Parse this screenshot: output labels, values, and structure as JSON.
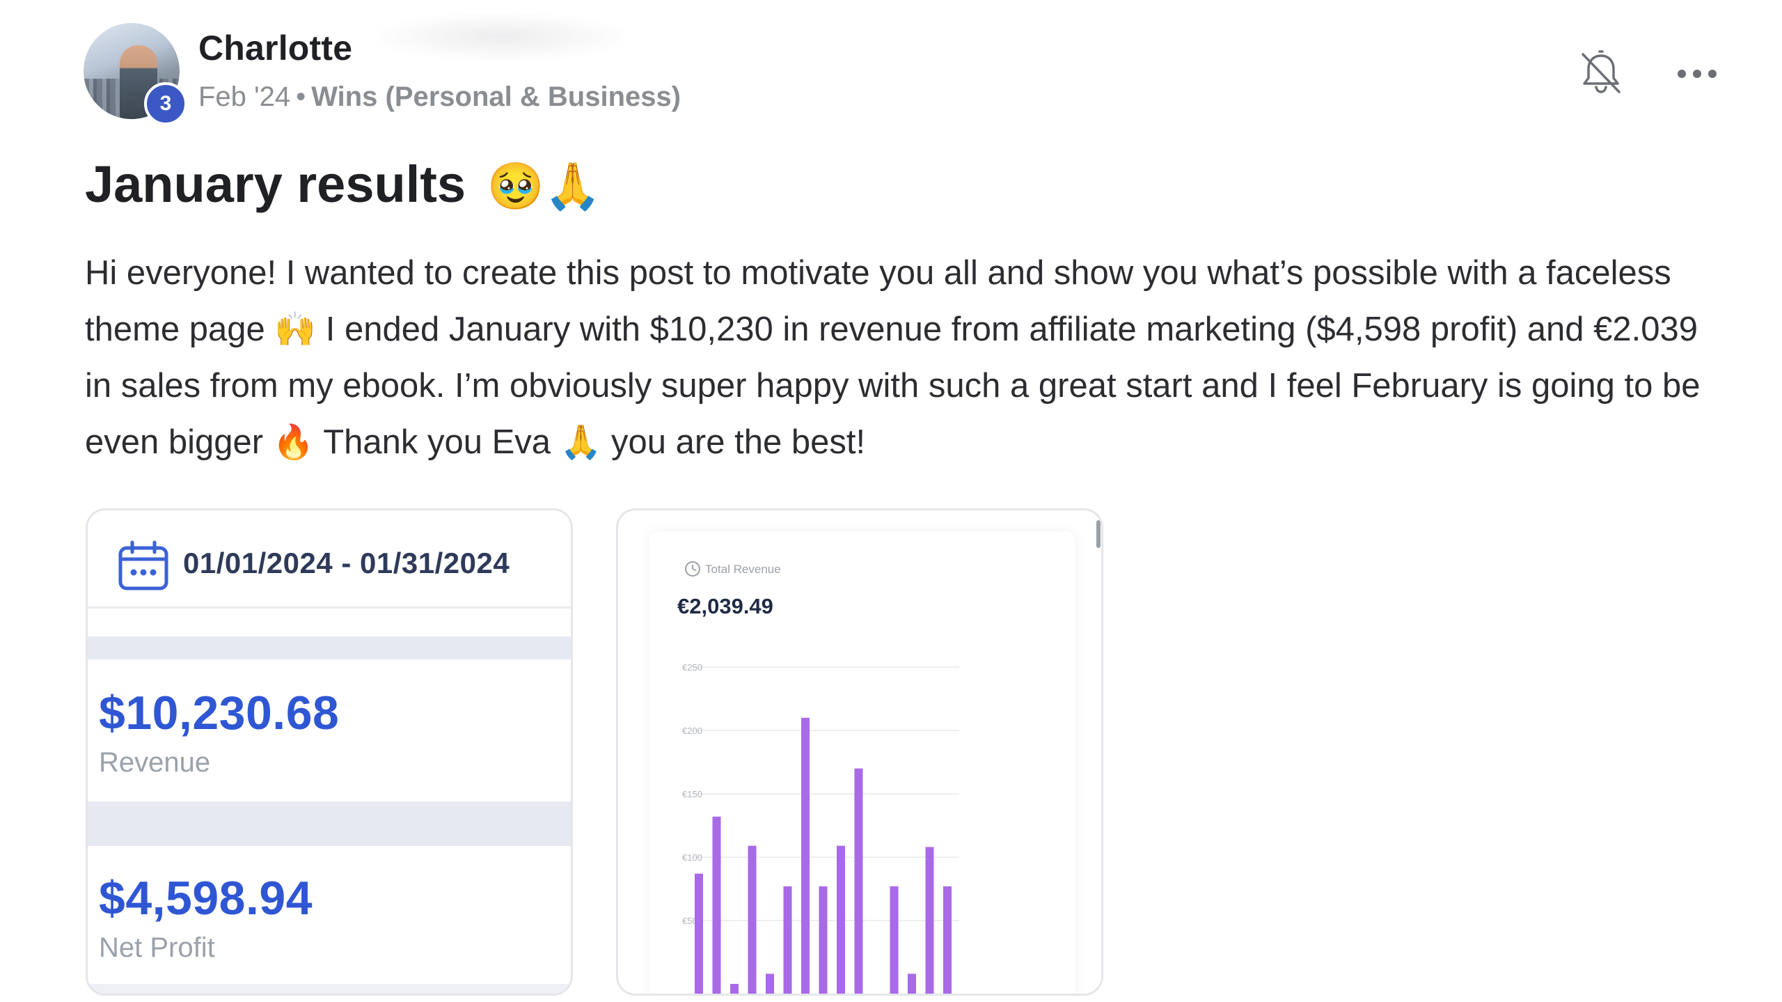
{
  "post": {
    "author": "Charlotte",
    "level": "3",
    "date": "Feb '24",
    "separator": "•",
    "category": "Wins (Personal & Business)",
    "title": "January results",
    "title_emojis": "🥹🙏",
    "body": {
      "part1": "Hi everyone! I wanted to create this post to motivate you all and show you what’s possible with a faceless theme page ",
      "emoji1": "🙌",
      "part2": " I ended January with $10,230 in revenue from affiliate marketing ($4,598 profit) and €2.039 in sales from my ebook. I’m obviously super happy with such a great start and I feel February is going to be even bigger ",
      "emoji2": "🔥",
      "part3": " Thank you Eva ",
      "emoji3": "🙏",
      "part4": " you are the best!"
    }
  },
  "icons": {
    "bell": "bell-off-icon",
    "more": "more-horizontal-icon",
    "calendar": "calendar-icon",
    "clock": "clock-icon"
  },
  "stats_card": {
    "date_range": "01/01/2024 - 01/31/2024",
    "revenue_value": "$10,230.68",
    "revenue_label": "Revenue",
    "profit_value": "$4,598.94",
    "profit_label": "Net Profit",
    "accent": "#2f56d3"
  },
  "revenue_card": {
    "label": "Total Revenue",
    "total": "€2,039.49",
    "bar_color": "#a86ae6"
  },
  "chart_data": {
    "type": "bar",
    "title": "Total Revenue",
    "ylabel": "",
    "xlabel": "",
    "ylim": [
      0,
      250
    ],
    "y_ticks": [
      "€250",
      "€200",
      "€150",
      "€100",
      "€50"
    ],
    "y_tick_values": [
      250,
      200,
      150,
      100,
      50
    ],
    "grid": true,
    "series": [
      {
        "values": [
          98,
          143,
          11,
          120,
          19,
          88,
          221,
          88,
          120,
          181,
          0,
          88,
          19,
          119,
          88
        ]
      }
    ]
  }
}
